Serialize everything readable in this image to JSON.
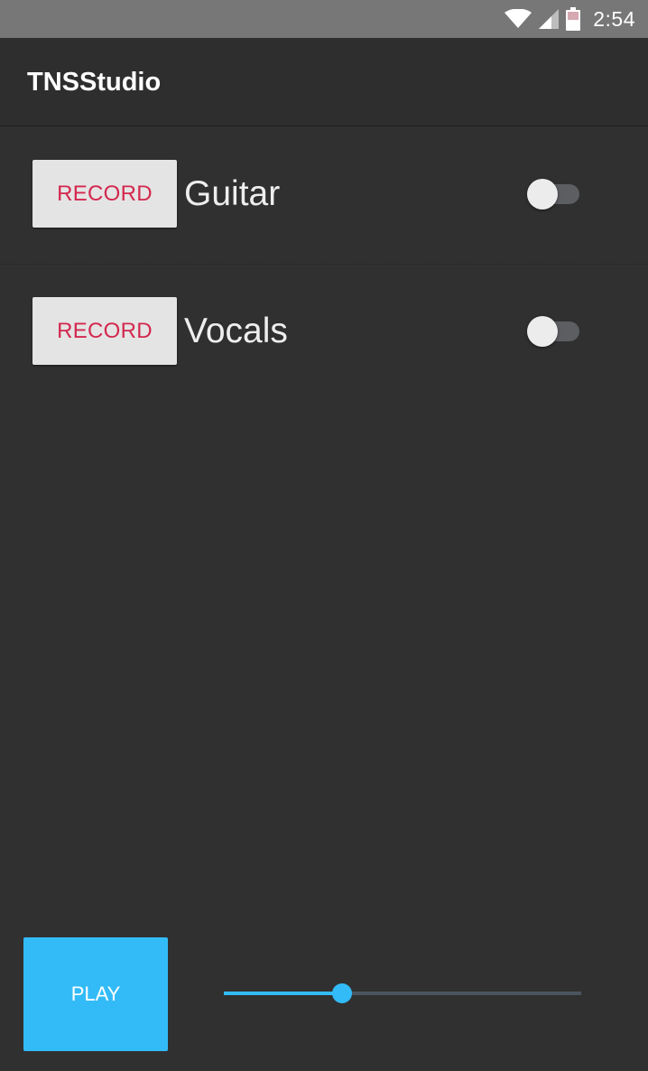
{
  "status_bar": {
    "time": "2:54",
    "icons": [
      "wifi-icon",
      "cell-signal-icon",
      "battery-icon"
    ]
  },
  "app": {
    "title": "TNSStudio"
  },
  "tracks": [
    {
      "record_label": "RECORD",
      "name": "Guitar",
      "enabled": false
    },
    {
      "record_label": "RECORD",
      "name": "Vocals",
      "enabled": false
    }
  ],
  "controls": {
    "play_label": "PLAY",
    "slider_value": 0.33
  },
  "colors": {
    "accent": "#33bbf7",
    "record_text": "#d3284e",
    "background": "#303030",
    "status_bar": "#777777"
  }
}
